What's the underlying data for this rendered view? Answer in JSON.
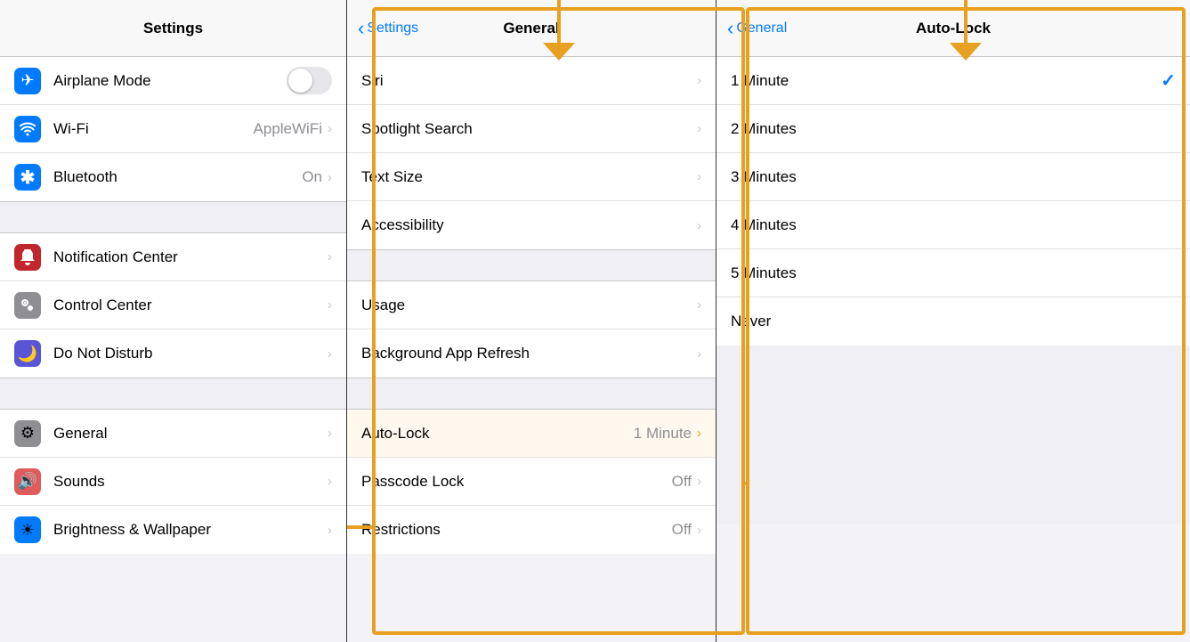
{
  "colors": {
    "blue": "#007aff",
    "orange": "#e8a020",
    "gray_bg": "#efeff4",
    "white": "#ffffff",
    "separator": "#c8c8c8",
    "text_primary": "#000000",
    "text_secondary": "#8e8e93",
    "chevron": "#c7c7cc"
  },
  "panel1": {
    "title": "Settings",
    "sections": [
      {
        "items": [
          {
            "icon": "✈",
            "icon_bg": "#007aff",
            "label": "Airplane Mode",
            "value": "",
            "has_toggle": true,
            "has_chevron": false
          },
          {
            "icon": "📶",
            "icon_bg": "#007aff",
            "label": "Wi-Fi",
            "value": "AppleWiFi",
            "has_toggle": false,
            "has_chevron": true
          },
          {
            "icon": "✱",
            "icon_bg": "#007aff",
            "label": "Bluetooth",
            "value": "On",
            "has_toggle": false,
            "has_chevron": true
          }
        ]
      },
      {
        "items": [
          {
            "icon": "🔔",
            "icon_bg": "#c1262c",
            "label": "Notification Center",
            "value": "",
            "has_toggle": false,
            "has_chevron": true
          },
          {
            "icon": "⊙",
            "icon_bg": "#8e8e93",
            "label": "Control Center",
            "value": "",
            "has_toggle": false,
            "has_chevron": true
          },
          {
            "icon": "☽",
            "icon_bg": "#5856d6",
            "label": "Do Not Disturb",
            "value": "",
            "has_toggle": false,
            "has_chevron": true
          }
        ]
      },
      {
        "items": [
          {
            "icon": "⚙",
            "icon_bg": "#8e8e93",
            "label": "General",
            "value": "",
            "has_toggle": false,
            "has_chevron": true
          },
          {
            "icon": "🔊",
            "icon_bg": "#e05b5b",
            "label": "Sounds",
            "value": "",
            "has_toggle": false,
            "has_chevron": true
          },
          {
            "icon": "☀",
            "icon_bg": "#007aff",
            "label": "Brightness & Wallpaper",
            "value": "",
            "has_toggle": false,
            "has_chevron": true
          }
        ]
      }
    ]
  },
  "panel2": {
    "nav": {
      "back_label": "Settings",
      "title": "General"
    },
    "sections": [
      {
        "items": [
          {
            "label": "Siri",
            "value": "",
            "has_chevron": true
          },
          {
            "label": "Spotlight Search",
            "value": "",
            "has_chevron": true
          },
          {
            "label": "Text Size",
            "value": "",
            "has_chevron": true
          },
          {
            "label": "Accessibility",
            "value": "",
            "has_chevron": true
          }
        ]
      },
      {
        "items": [
          {
            "label": "Usage",
            "value": "",
            "has_chevron": true
          },
          {
            "label": "Background App Refresh",
            "value": "",
            "has_chevron": true
          }
        ]
      },
      {
        "items": [
          {
            "label": "Auto-Lock",
            "value": "1 Minute",
            "has_chevron": true,
            "highlighted": true
          },
          {
            "label": "Passcode Lock",
            "value": "Off",
            "has_chevron": true
          },
          {
            "label": "Restrictions",
            "value": "Off",
            "has_chevron": true
          }
        ]
      }
    ]
  },
  "panel3": {
    "nav": {
      "back_label": "General",
      "title": "Auto-Lock"
    },
    "items": [
      {
        "label": "1 Minute",
        "selected": true
      },
      {
        "label": "2 Minutes",
        "selected": false
      },
      {
        "label": "3 Minutes",
        "selected": false
      },
      {
        "label": "4 Minutes",
        "selected": false
      },
      {
        "label": "5 Minutes",
        "selected": false
      },
      {
        "label": "Never",
        "selected": false
      }
    ]
  }
}
